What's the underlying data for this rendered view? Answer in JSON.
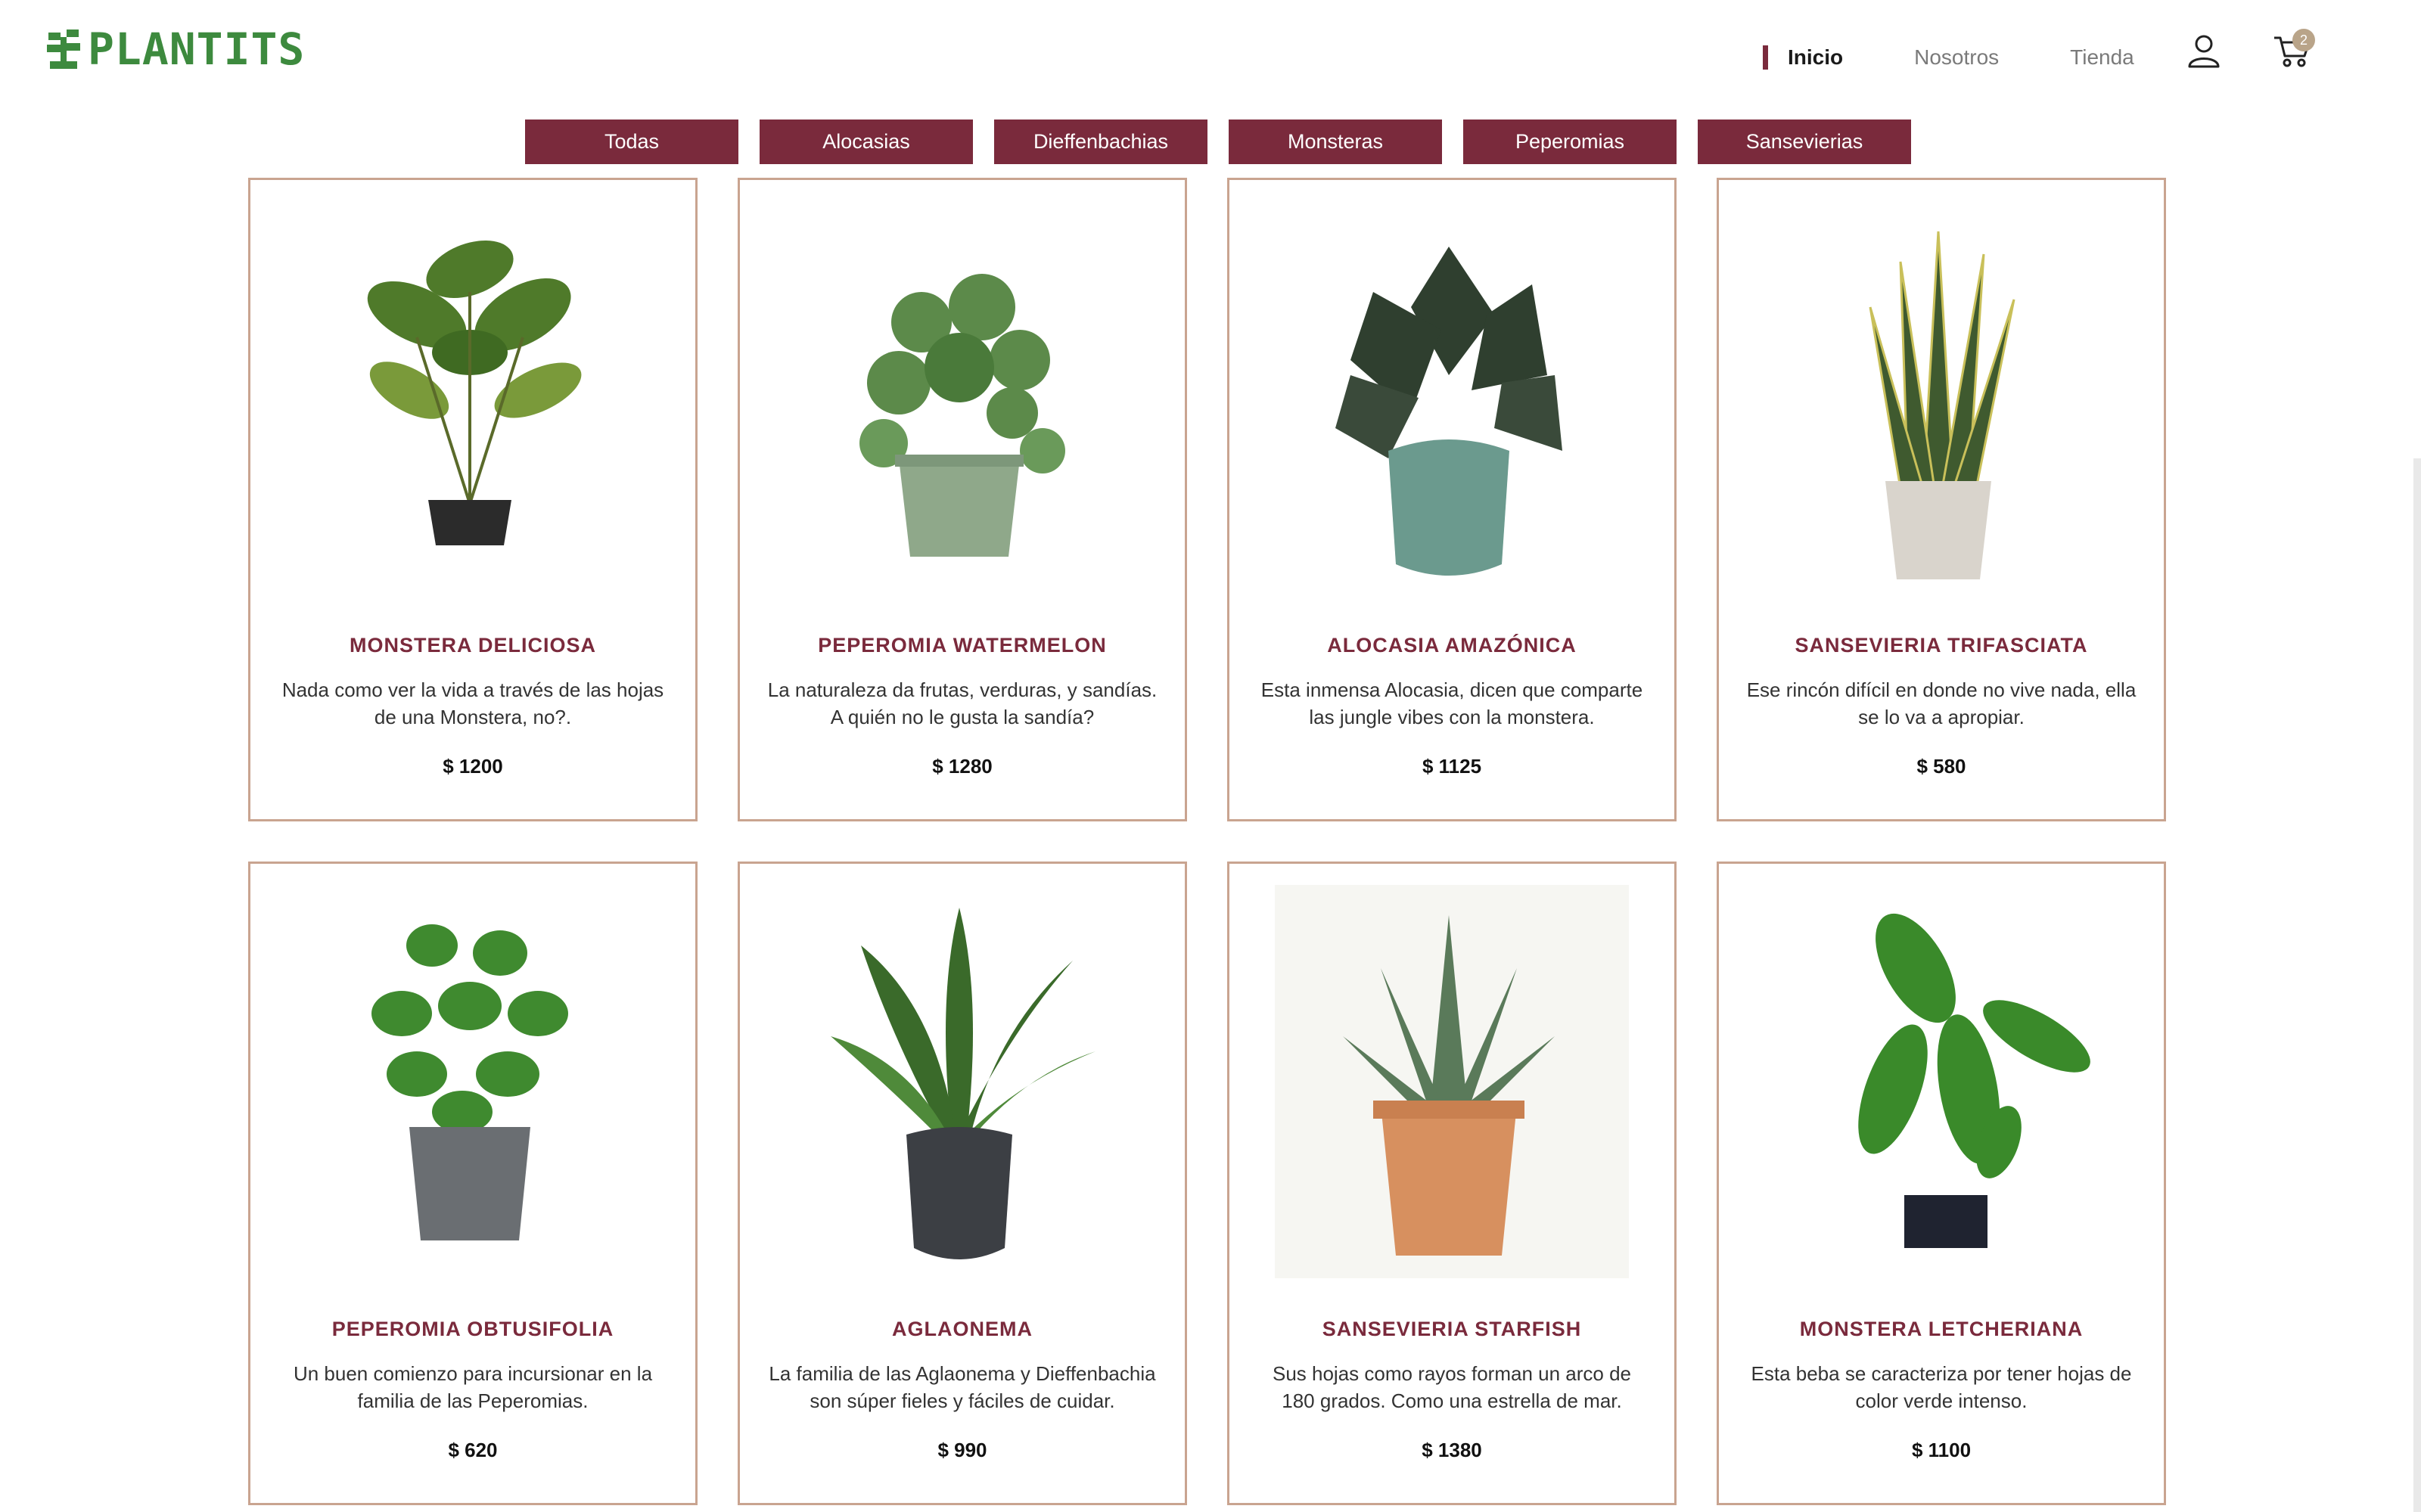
{
  "brand": {
    "name": "PLANTITS",
    "accent": "#7a2a3c",
    "logo_green": "#3d8a3e"
  },
  "nav": {
    "items": [
      {
        "label": "Inicio",
        "active": true
      },
      {
        "label": "Nosotros",
        "active": false
      },
      {
        "label": "Tienda",
        "active": false
      }
    ],
    "user_icon": "user-icon",
    "cart_icon": "cart-icon",
    "cart_count": "2"
  },
  "filters": [
    "Todas",
    "Alocasias",
    "Dieffenbachias",
    "Monsteras",
    "Peperomias",
    "Sansevierias"
  ],
  "products": [
    {
      "title": "MONSTERA DELICIOSA",
      "description": "Nada como ver la vida a través de las hojas de una Monstera, no?.",
      "price": "$ 1200",
      "pot": "black"
    },
    {
      "title": "PEPEROMIA WATERMELON",
      "description": "La naturaleza da frutas, verduras, y sandías. A quién no le gusta la sandía?",
      "price": "$ 1280",
      "pot": "sage"
    },
    {
      "title": "ALOCASIA AMAZÓNICA",
      "description": "Esta inmensa Alocasia, dicen que comparte las jungle vibes con la monstera.",
      "price": "$ 1125",
      "pot": "teal"
    },
    {
      "title": "SANSEVIERIA TRIFASCIATA",
      "description": "Ese rincón difícil en donde no vive nada, ella se lo va a apropiar.",
      "price": "$ 580",
      "pot": "cream"
    },
    {
      "title": "PEPEROMIA OBTUSIFOLIA",
      "description": "Un buen comienzo para incursionar en la familia de las Peperomias.",
      "price": "$ 620",
      "pot": "grey"
    },
    {
      "title": "AGLAONEMA",
      "description": "La familia de las Aglaonema y Dieffenbachia son súper fieles y fáciles de cuidar.",
      "price": "$ 990",
      "pot": "charcoal"
    },
    {
      "title": "SANSEVIERIA STARFISH",
      "description": "Sus hojas como rayos forman un arco de 180 grados. Como una estrella de mar.",
      "price": "$ 1380",
      "pot": "terracotta"
    },
    {
      "title": "MONSTERA LETCHERIANA",
      "description": "Esta beba se caracteriza por tener hojas de color verde intenso.",
      "price": "$ 1100",
      "pot": "black"
    }
  ]
}
